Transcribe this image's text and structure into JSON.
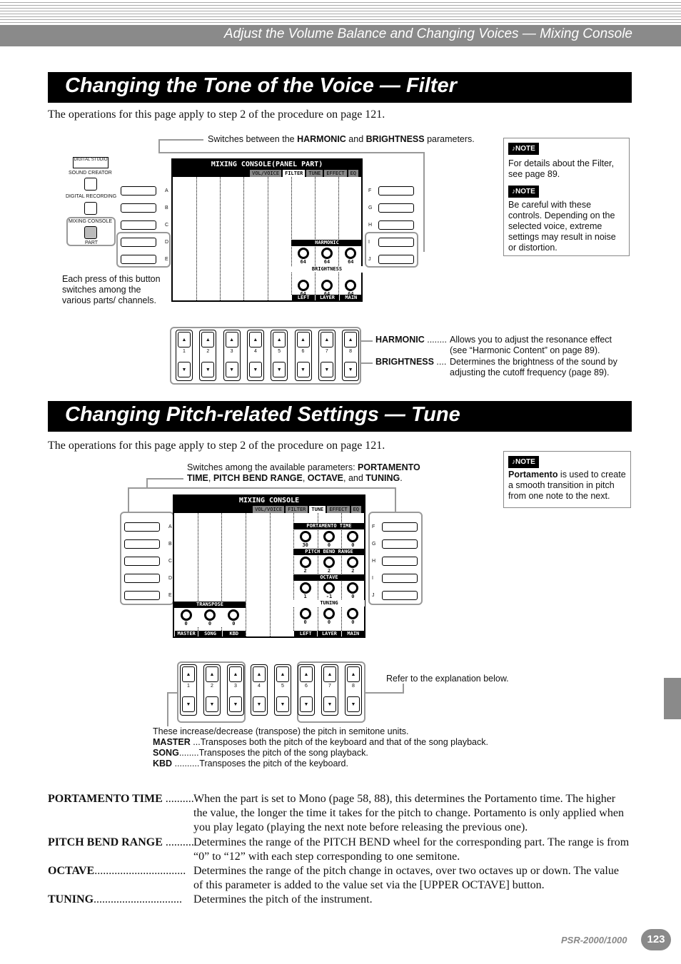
{
  "header": {
    "title": "Adjust the Volume Balance and Changing Voices — Mixing Console"
  },
  "section1": {
    "title": "Changing the Tone of the Voice — Filter",
    "intro": "The operations for this page apply to step 2 of the procedure on page 121.",
    "callout_top": "Switches between the HARMONIC and BRIGHTNESS parameters.",
    "callout_left": "Each press of this button switches among the various parts/ channels.",
    "panel": {
      "digital_studio": "DIGITAL STUDIO",
      "sound_creator": "SOUND CREATOR",
      "digital_recording": "DIGITAL RECORDING",
      "mixing_console": "MIXING CONSOLE",
      "part": "PART"
    },
    "lcd": {
      "title": "MIXING CONSOLE(PANEL PART)",
      "tabs": [
        "VOL/VOICE",
        "FILTER",
        "TUNE",
        "EFFECT",
        "EQ"
      ],
      "active_tab": "FILTER",
      "groups": [
        {
          "name": "HARMONIC",
          "values": [
            "64",
            "64",
            "64"
          ]
        },
        {
          "name": "BRIGHTNESS",
          "values": [
            "64",
            "64",
            "64"
          ]
        }
      ],
      "footer": [
        "LEFT",
        "LAYER",
        "MAIN"
      ]
    },
    "left_letters": [
      "A",
      "B",
      "C",
      "D",
      "E"
    ],
    "right_letters": [
      "F",
      "G",
      "H",
      "I",
      "J"
    ],
    "numbers": [
      "1",
      "2",
      "3",
      "4",
      "5",
      "6",
      "7",
      "8"
    ],
    "legend": [
      {
        "term": "HARMONIC",
        "dots": " ........ ",
        "desc": "Allows you to adjust the resonance effect (see “Harmonic Content” on page 89)."
      },
      {
        "term": "BRIGHTNESS",
        "dots": " .... ",
        "desc": "Determines the brightness of the sound by adjusting the cutoff frequency (page 89)."
      }
    ],
    "notes": [
      {
        "badge": "♪NOTE",
        "text": "For details about the Filter, see page 89."
      },
      {
        "badge": "♪NOTE",
        "text": "Be careful with these controls. Depending on the selected voice, extreme settings may result in noise or distortion."
      }
    ]
  },
  "section2": {
    "title": "Changing Pitch-related Settings — Tune",
    "intro": "The operations for this page apply to step 2 of the procedure on page 121.",
    "callout_top": "Switches among the available parameters: PORTAMENTO TIME, PITCH BEND RANGE, OCTAVE, and TUNING.",
    "callout_right": "Refer to the explanation below.",
    "note": {
      "badge": "♪NOTE",
      "bold": "Portamento",
      "text": " is used to create a smooth transition in pitch from one note to the next."
    },
    "lcd": {
      "title": "MIXING CONSOLE",
      "tabs": [
        "VOL/VOICE",
        "FILTER",
        "TUNE",
        "EFFECT",
        "EQ"
      ],
      "active_tab": "TUNE",
      "transpose": {
        "name": "TRANSPOSE",
        "values": [
          "0",
          "0",
          "0"
        ],
        "footer": [
          "MASTER",
          "SONG",
          "KBD"
        ]
      },
      "groups": [
        {
          "name": "PORTAMENTO TIME",
          "values": [
            "30",
            "0",
            "0"
          ]
        },
        {
          "name": "PITCH BEND RANGE",
          "values": [
            "2",
            "2",
            "2"
          ]
        },
        {
          "name": "OCTAVE",
          "values": [
            "1",
            "-1",
            "0"
          ]
        },
        {
          "name": "TUNING",
          "values": [
            "0",
            "0",
            "0"
          ]
        }
      ],
      "footer": [
        "LEFT",
        "LAYER",
        "MAIN"
      ]
    },
    "transpose_text": {
      "intro": "These increase/decrease (transpose) the pitch in semitone units.",
      "items": [
        {
          "term": "MASTER",
          "dots": " ...",
          "desc": "Transposes both the pitch of the keyboard and that of the song playback."
        },
        {
          "term": "SONG",
          "dots": "........",
          "desc": "Transposes the pitch of the song playback."
        },
        {
          "term": "KBD",
          "dots": " ..........",
          "desc": "Transposes the pitch of the keyboard."
        }
      ]
    },
    "definitions": [
      {
        "term": "PORTAMENTO TIME",
        "dots": " ............",
        "desc": "When the part is set to Mono (page 58, 88), this determines the Portamento time. The higher the value, the longer the time it takes for the pitch to change. Portamento is only applied when you play legato (playing the next note before releasing the previous one)."
      },
      {
        "term": "PITCH BEND RANGE",
        "dots": " ...........",
        "desc": "Determines the range of the PITCH BEND wheel for the corresponding part. The range is from “0” to “12” with each step corresponding to one semitone."
      },
      {
        "term": "OCTAVE",
        "dots": "................................",
        "desc": "Determines the range of the pitch change in octaves, over two octaves up or down. The value of this parameter is added to the value set via the [UPPER OCTAVE] button."
      },
      {
        "term": "TUNING",
        "dots": "...............................",
        "desc": "Determines the pitch of the instrument."
      }
    ]
  },
  "footer": {
    "model": "PSR-2000/1000",
    "page": "123"
  },
  "colors": {
    "band": "#8a8a8a",
    "bar": "#000000",
    "frame": "#999999"
  }
}
